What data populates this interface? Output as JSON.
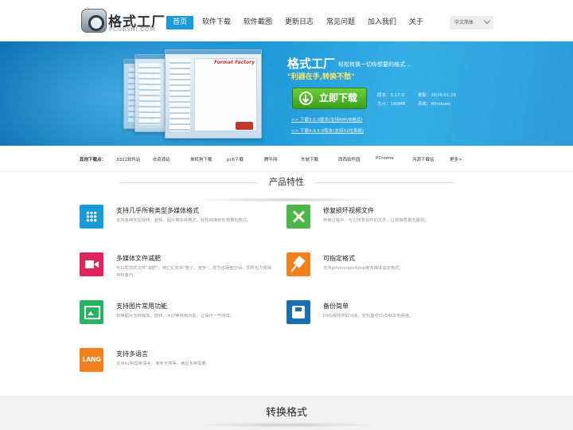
{
  "header": {
    "logo_cn": "格式工厂",
    "logo_en": "PCGESHI.COM",
    "nav": [
      {
        "label": "首页",
        "active": true
      },
      {
        "label": "软件下载"
      },
      {
        "label": "软件截图"
      },
      {
        "label": "更新日志"
      },
      {
        "label": "常见问题"
      },
      {
        "label": "加入我们"
      },
      {
        "label": "关于"
      }
    ],
    "language": "中文简体"
  },
  "banner": {
    "title": "格式工厂",
    "subtitle": "轻松转换一切你想要的格式...",
    "slogan": "\"利器在手,转换不愁\"",
    "download_label": "立即下载",
    "screenshot_caption": "Format Factory",
    "version": "版本：5.17.0",
    "updated": "更新：2024.01.26",
    "size": "大小：100MB",
    "system": "系统：Windows",
    "links": [
      ">> 下载3.0.0版本(支持RMVB格式)",
      ">> 下载4.9.5.0版本(支持32位系统)"
    ]
  },
  "other_downloads": {
    "label": "其他下载点：",
    "sites": [
      "3322软件站",
      "IE资源站",
      "单机狗下载",
      "pc6下载",
      "腾牛网",
      "东坡下载",
      "西西软件园",
      "PChome",
      "河源下载站",
      "更多>"
    ]
  },
  "features_section": {
    "title": "产品特性",
    "items": [
      {
        "title": "支持几乎所有类型多媒体格式",
        "desc": "支持各种类型视频、音频、图片等多种格式，轻松转换到你想要的格式。",
        "icon": "grid-icon",
        "color": "#1a9ad6"
      },
      {
        "title": "修复损坏视频文件",
        "desc": "转换过程中，可以修复损坏的文件，让转换质量无破损。",
        "icon": "tools-icon",
        "color": "#4cb648"
      },
      {
        "title": "多媒体文件减肥",
        "desc": "可以帮您的文件\"减肥\"，使它们变得\"瘦小、苗条\"。既节省硬盘空间，同时也方便保存和备份。",
        "icon": "video-camera-icon",
        "color": "#e0245e"
      },
      {
        "title": "可指定格式",
        "desc": "支持iphone/ipod/psp等多媒体指定格式。",
        "icon": "pushpin-icon",
        "color": "#f0811d"
      },
      {
        "title": "支持图片常用功能",
        "desc": "转换图片支持缩放、旋转、水印等常用功能，让操作一气呵成。",
        "icon": "image-icon",
        "color": "#27b562"
      },
      {
        "title": "备份简单",
        "desc": "DVD视频抓取功能，轻松备份DVD到本地硬盘。",
        "icon": "floppy-disk-icon",
        "color": "#1a6fae"
      },
      {
        "title": "支持多语言",
        "desc": "支持62种国家语言，使用无障碍，满足多种需要。",
        "icon": "language-icon",
        "icon_text": "LANG",
        "color": "#f0811d"
      }
    ]
  },
  "convert_section": {
    "title": "转换格式"
  }
}
